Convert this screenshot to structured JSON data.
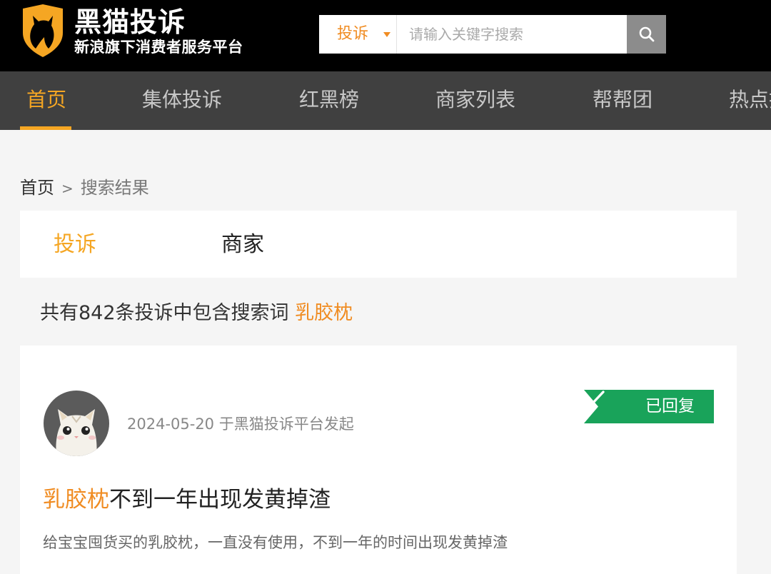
{
  "brand": {
    "title": "黑猫投诉",
    "subtitle": "新浪旗下消费者服务平台"
  },
  "search": {
    "category": "投诉",
    "placeholder": "请输入关键字搜索"
  },
  "nav": {
    "items": [
      "首页",
      "集体投诉",
      "红黑榜",
      "商家列表",
      "帮帮团",
      "热点投诉"
    ],
    "active_index": 0
  },
  "breadcrumb": {
    "home": "首页",
    "separator": ">",
    "current": "搜索结果"
  },
  "tabs": [
    "投诉",
    "商家"
  ],
  "results": {
    "summary_prefix": "共有842条投诉中包含搜索词",
    "keyword": "乳胶枕"
  },
  "complaint": {
    "meta": "2024-05-20 于黑猫投诉平台发起",
    "status": "已回复",
    "title_keyword": "乳胶枕",
    "title_rest": "不到一年出现发黄掉渣",
    "description": "给宝宝囤货买的乳胶枕，一直没有使用，不到一年的时间出现发黄掉渣"
  },
  "colors": {
    "accent": "#f5a623",
    "keyword": "#f08c22",
    "status_green": "#19a35a"
  }
}
